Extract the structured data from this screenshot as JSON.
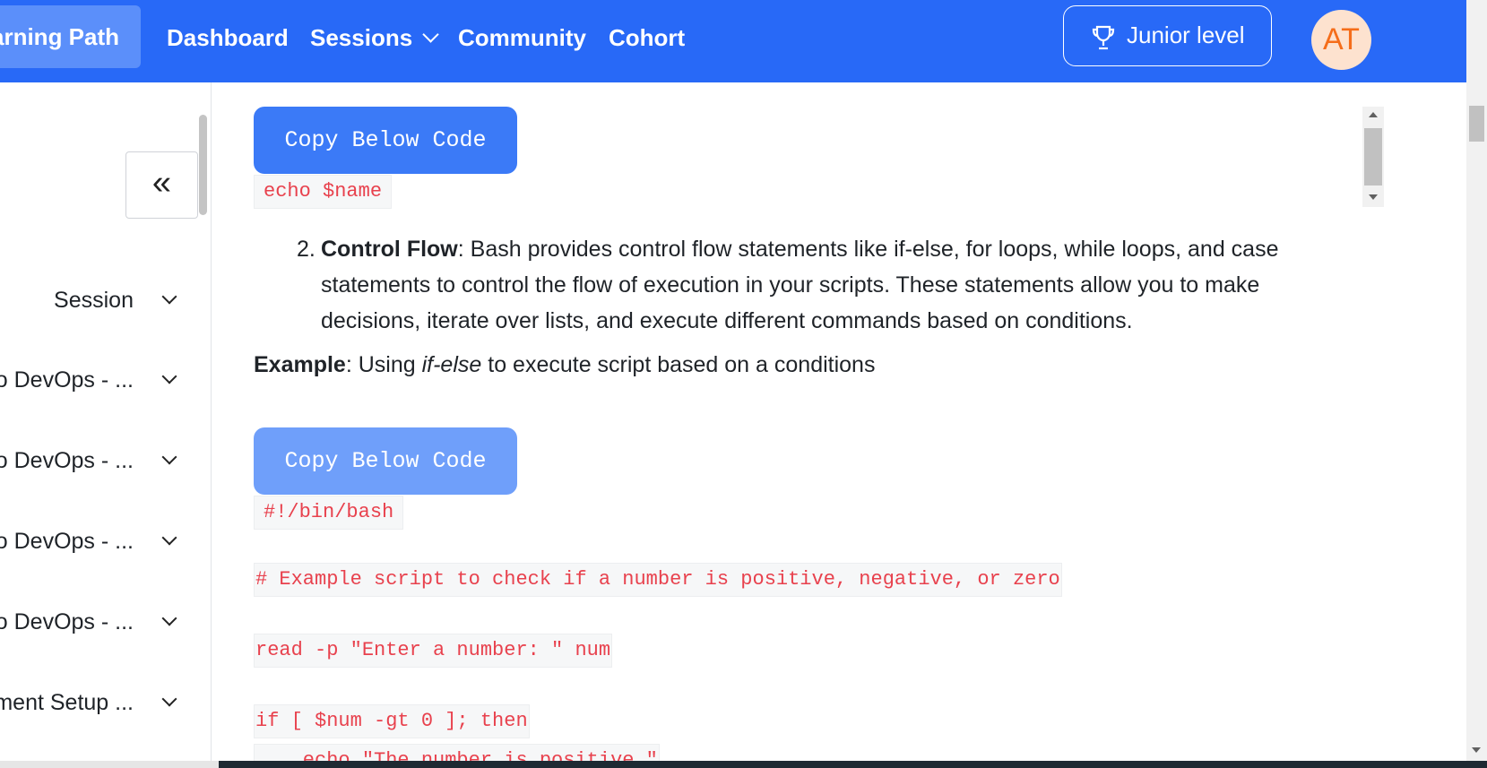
{
  "nav": {
    "active_label": "arning Path",
    "links": [
      "Dashboard",
      "Sessions",
      "Community",
      "Cohort"
    ],
    "level_label": "Junior level",
    "avatar_initials": "AT",
    "brand_color": "#2869f7"
  },
  "sidebar": {
    "collapse_icon": "«",
    "items": [
      "Session",
      "to DevOps - ...",
      "to DevOps - ...",
      "to DevOps - ...",
      "to DevOps - ...",
      "nment Setup ..."
    ]
  },
  "content": {
    "copy_button_label": "Copy Below Code",
    "code_1": "echo $name",
    "list_number": "2.",
    "control_flow_title": "Control Flow",
    "control_flow_text": ": Bash provides control flow statements like if-else, for loops, while loops, and case statements to control the flow of execution in your scripts. These statements allow you to make decisions, iterate over lists, and execute different commands based on conditions.",
    "example_label": "Example",
    "example_prefix": ": Using ",
    "example_italic": "if-else",
    "example_suffix": " to execute script based on a conditions",
    "code_lines": [
      "#!/bin/bash",
      "# Example script to check if a number is positive, negative, or zero",
      "read -p \"Enter a number: \" num",
      "if [ $num -gt 0 ]; then",
      "    echo \"The number is positive.\""
    ]
  }
}
